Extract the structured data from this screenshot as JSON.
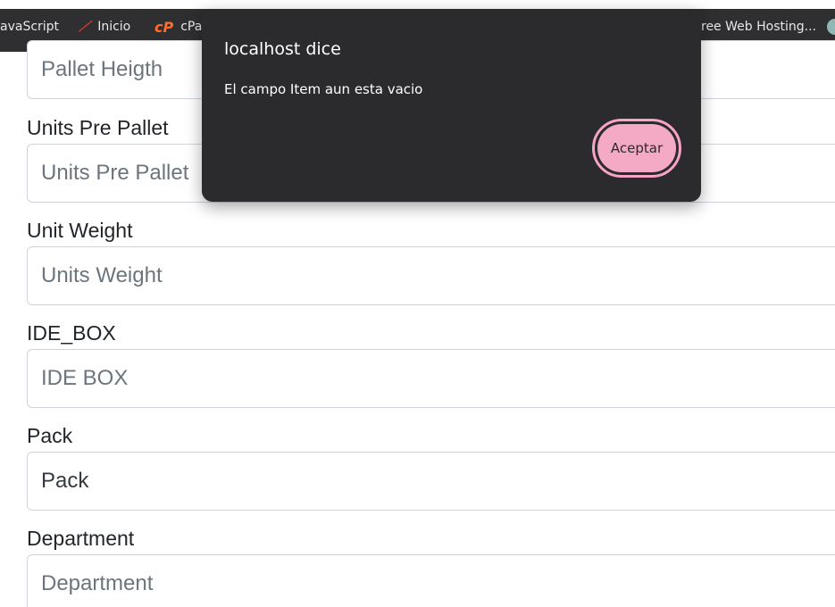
{
  "bookmarks": {
    "items": [
      {
        "label": "avaScript"
      },
      {
        "label": "Inicio",
        "icon": "inicio-icon"
      },
      {
        "label": "cPa",
        "icon": "cpanel-icon"
      },
      {
        "label": "ree Web Hosting..."
      },
      {
        "label": "",
        "icon": "site-icon"
      }
    ]
  },
  "form": {
    "pallet_height": {
      "placeholder": "Pallet Heigth"
    },
    "units_per_pallet": {
      "label": "Units Pre Pallet",
      "placeholder": "Units Pre Pallet"
    },
    "unit_weight": {
      "label": "Unit Weight",
      "placeholder": "Units Weight"
    },
    "ide_box": {
      "label": "IDE_BOX",
      "placeholder": "IDE BOX"
    },
    "pack": {
      "label": "Pack",
      "value": "Pack"
    },
    "department": {
      "label": "Department",
      "placeholder": "Department"
    }
  },
  "dialog": {
    "title": "localhost dice",
    "message": "El campo Item aun esta vacio",
    "accept_label": "Aceptar"
  },
  "colors": {
    "bookmarks_bg": "#2f2f31",
    "dialog_bg": "#2b2b2d",
    "accept_button_bg": "#f4a9c4",
    "accept_button_ring": "#f6a3c6"
  }
}
